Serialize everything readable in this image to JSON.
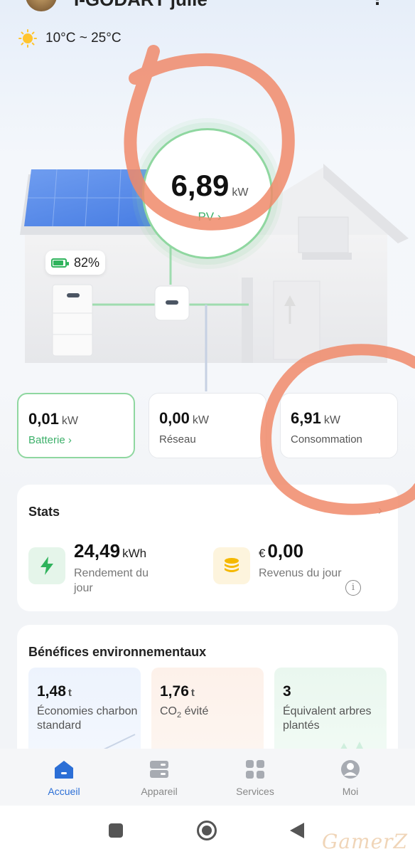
{
  "header": {
    "plant_name": "I-GODART julie",
    "menu_glyph": "⋮"
  },
  "weather": {
    "icon": "sun-icon",
    "range": "10°C ~ 25°C"
  },
  "pv": {
    "value": "6,89",
    "unit": "kW",
    "link": "PV ›"
  },
  "battery_badge": {
    "percent": "82%",
    "level": 0.82
  },
  "summary": [
    {
      "value": "0,01",
      "unit": "kW",
      "label": "Batterie ›",
      "active": true
    },
    {
      "value": "0,00",
      "unit": "kW",
      "label": "Réseau",
      "active": false
    },
    {
      "value": "6,91",
      "unit": "kW",
      "label": "Consommation",
      "active": false
    }
  ],
  "stats": {
    "title": "Stats",
    "chevron": "›",
    "items": [
      {
        "icon": "lightning-icon",
        "value": "24,49",
        "unit": "kWh",
        "label": "Rendement du jour"
      },
      {
        "icon": "coins-icon",
        "currency": "€",
        "value": "0,00",
        "label": "Revenus du jour"
      }
    ],
    "info": "i"
  },
  "env": {
    "title": "Bénéfices environnementaux",
    "tiles": [
      {
        "value": "1,48",
        "unit": "t",
        "label": "Économies charbon standard"
      },
      {
        "value": "1,76",
        "unit": "t",
        "label_prefix": "CO",
        "label_sub": "2",
        "label_suffix": " évité"
      },
      {
        "value": "3",
        "unit": "",
        "label": "Équivalent arbres plantés"
      }
    ]
  },
  "nav": [
    {
      "label": "Accueil",
      "icon": "home-icon",
      "active": true
    },
    {
      "label": "Appareil",
      "icon": "device-icon",
      "active": false
    },
    {
      "label": "Services",
      "icon": "grid-icon",
      "active": false
    },
    {
      "label": "Moi",
      "icon": "profile-icon",
      "active": false
    }
  ],
  "watermark": "GamerZ",
  "colors": {
    "accent_green": "#3db06a",
    "accent_blue": "#2c6fd6",
    "annotation": "#f08a6a"
  }
}
